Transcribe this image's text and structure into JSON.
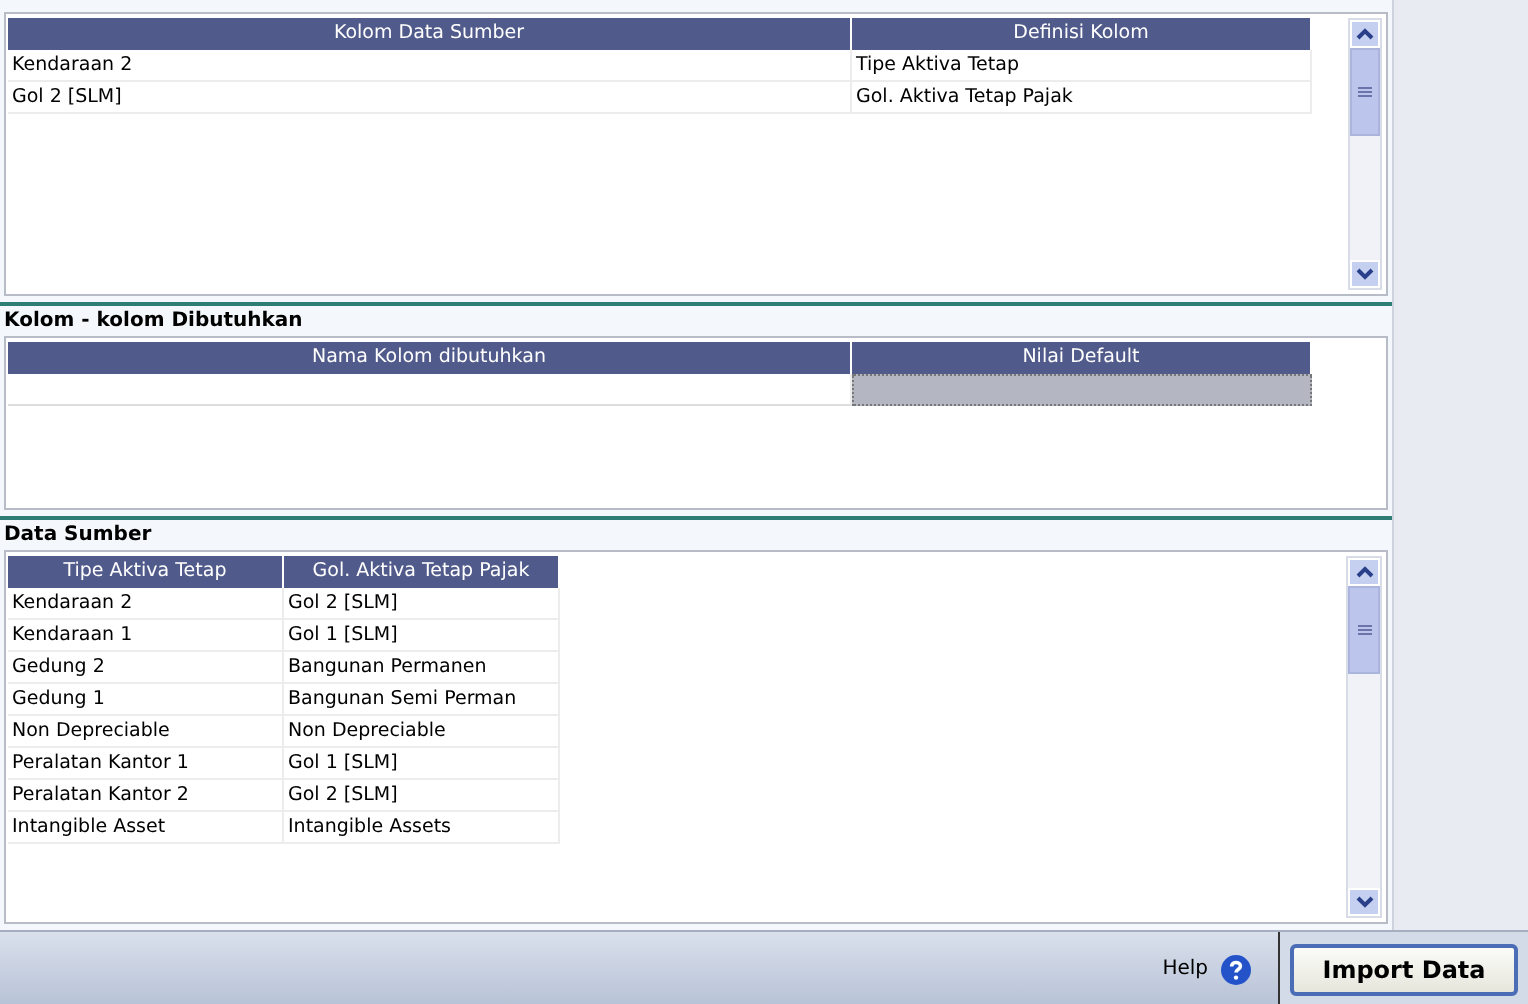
{
  "mapping_table": {
    "columns": [
      "Kolom Data Sumber",
      "Definisi Kolom"
    ],
    "rows": [
      [
        "Kendaraan 2",
        "Tipe Aktiva Tetap"
      ],
      [
        "Gol 2 [SLM]",
        "Gol. Aktiva Tetap Pajak"
      ]
    ]
  },
  "required_section": {
    "title": "Kolom - kolom Dibutuhkan",
    "columns": [
      "Nama Kolom dibutuhkan",
      "Nilai Default"
    ]
  },
  "source_section": {
    "title": "Data Sumber",
    "columns": [
      "Tipe Aktiva Tetap",
      "Gol. Aktiva Tetap Pajak"
    ],
    "rows": [
      [
        "Kendaraan 2",
        "Gol 2 [SLM]"
      ],
      [
        "Kendaraan 1",
        "Gol 1 [SLM]"
      ],
      [
        "Gedung 2",
        "Bangunan Permanen"
      ],
      [
        "Gedung 1",
        "Bangunan Semi Perman"
      ],
      [
        "Non Depreciable",
        "Non Depreciable"
      ],
      [
        "Peralatan Kantor 1",
        "Gol 1 [SLM]"
      ],
      [
        "Peralatan Kantor 2",
        "Gol 2 [SLM]"
      ],
      [
        "Intangible Asset",
        "Intangible Assets"
      ]
    ]
  },
  "footer": {
    "help_label": "Help",
    "import_button": "Import Data"
  }
}
